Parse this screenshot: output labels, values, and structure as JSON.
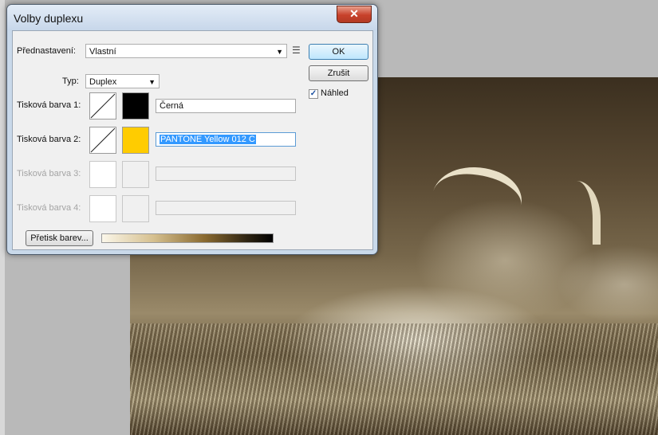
{
  "dialog": {
    "title": "Volby duplexu",
    "close_icon": "close-icon",
    "close_glyph": "✕"
  },
  "preset": {
    "label": "Přednastavení:",
    "value": "Vlastní",
    "menu_icon": "options-menu-icon"
  },
  "type": {
    "label": "Typ:",
    "value": "Duplex"
  },
  "buttons": {
    "ok": "OK",
    "cancel": "Zrušit",
    "overprint": "Přetisk barev..."
  },
  "preview": {
    "label": "Náhled",
    "checked": true
  },
  "inks": [
    {
      "label": "Tisková barva 1:",
      "color": "#000000",
      "name": "Černá",
      "enabled": true
    },
    {
      "label": "Tisková barva 2:",
      "color": "#ffcc00",
      "name": "PANTONE Yellow 012 C",
      "enabled": true,
      "selected": true
    },
    {
      "label": "Tisková barva 3:",
      "color": "",
      "name": "",
      "enabled": false
    },
    {
      "label": "Tisková barva 4:",
      "color": "",
      "name": "",
      "enabled": false
    }
  ],
  "colors": {
    "dialog_frame": "#c9d9ea",
    "close_button": "#c7412b",
    "selection": "#3399ff"
  }
}
